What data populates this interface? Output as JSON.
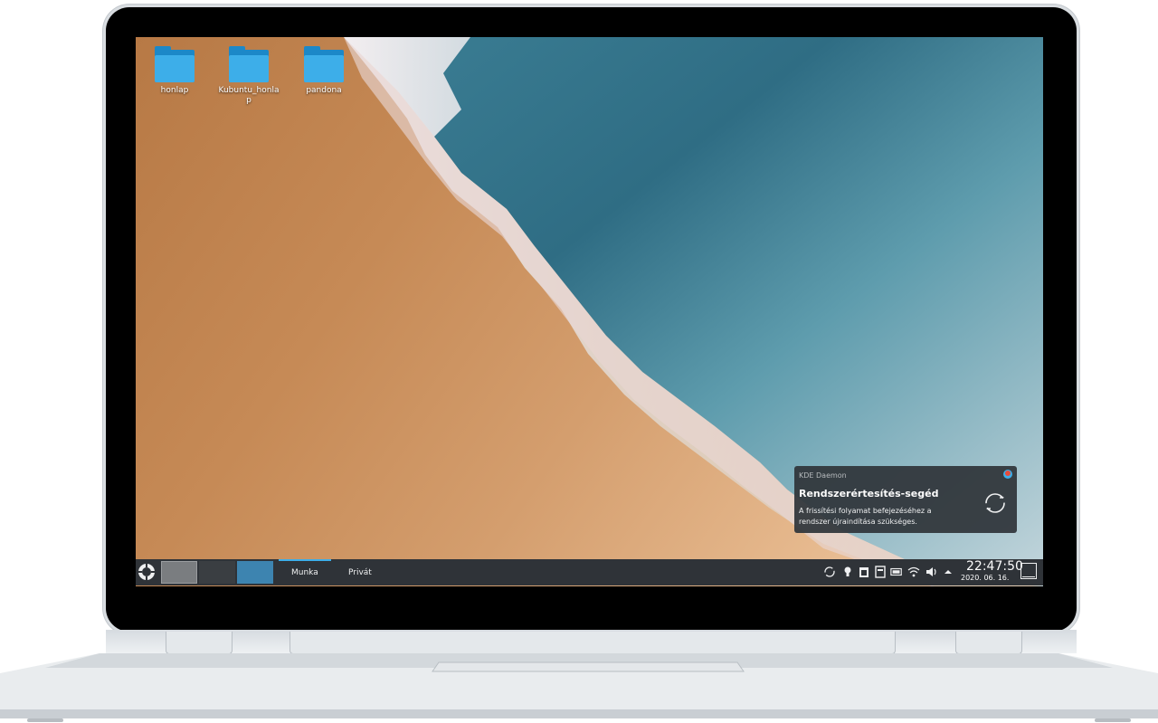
{
  "desktop": {
    "icons": [
      {
        "label": "honlap"
      },
      {
        "label": "Kubuntu_honla p"
      },
      {
        "label": "pandona"
      }
    ]
  },
  "notification": {
    "app_name": "KDE Daemon",
    "title": "Rendszerértesítés-segéd",
    "body": "A frissítési folyamat befejezéséhez a rendszer újraindítása szükséges.",
    "icon": "update-refresh-icon"
  },
  "taskbar": {
    "launcher_icon": "kde-launcher-icon",
    "activities": [
      {
        "label": "Munka",
        "active": true
      },
      {
        "label": "Privát",
        "active": false
      }
    ],
    "tray_icons": [
      "updates-icon",
      "lightbulb-icon",
      "clipboard-icon",
      "notes-icon",
      "battery-icon",
      "wifi-icon",
      "volume-icon",
      "expand-tray-icon"
    ],
    "clock": {
      "time": "22:47:50",
      "date": "2020. 06. 16."
    }
  },
  "colors": {
    "accent": "#3daee9",
    "panel": "#2f3338",
    "notification_bg": "#31363b"
  }
}
